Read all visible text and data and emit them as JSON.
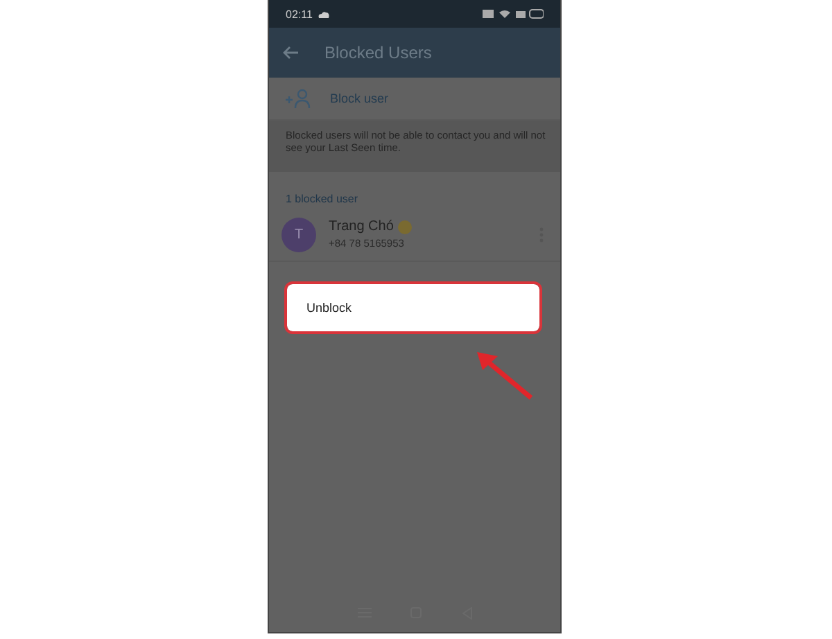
{
  "status_bar": {
    "time": "02:11"
  },
  "app_bar": {
    "title": "Blocked Users"
  },
  "block_user": {
    "label": "Block user"
  },
  "info": {
    "text": "Blocked users will not be able to contact you and will not see your Last Seen time."
  },
  "section": {
    "title": "1 blocked user"
  },
  "users": [
    {
      "initial": "T",
      "name": "Trang Chó",
      "phone": "+84 78 5165953"
    }
  ],
  "menu": {
    "items": [
      {
        "label": "Unblock",
        "highlighted": true
      }
    ]
  }
}
